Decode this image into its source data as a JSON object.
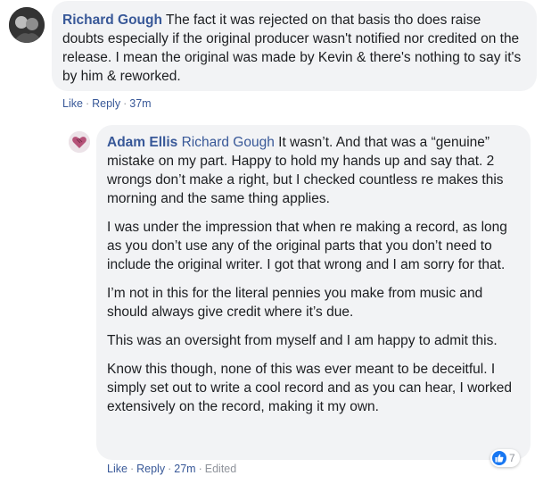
{
  "comment": {
    "author": "Richard Gough",
    "text": "The fact it was rejected on that basis tho does raise doubts especially if the original producer wasn't notified nor credited on the release. I mean the original was made by Kevin & there's nothing to say it's by him & reworked.",
    "actions": {
      "like": "Like",
      "reply": "Reply",
      "time": "37m"
    }
  },
  "reply": {
    "author": "Adam Ellis",
    "mention": "Richard Gough",
    "paragraphs": [
      "It wasn’t. And that was a “genuine” mistake on my part. Happy to hold my hands up and say that. 2 wrongs don’t make a right, but I checked countless re makes this morning and the same thing applies.",
      "I was under the impression that when re making a record, as long as you don’t use any of the original parts that you don’t need to include the original writer. I got that wrong and I am sorry for that.",
      "I’m not in this for the literal pennies you make from music and should always give credit where it’s due.",
      "This was an oversight from myself and I am happy to admit this.",
      "Know this though, none of this was ever meant to be deceitful. I simply set out to write a cool record and as you can hear, I worked extensively on the record, making it my own."
    ],
    "actions": {
      "like": "Like",
      "reply": "Reply",
      "time": "27m",
      "edited": "Edited"
    },
    "reactions": {
      "icon": "thumbs-up-icon",
      "count": "7",
      "color": "#1877f2"
    }
  }
}
